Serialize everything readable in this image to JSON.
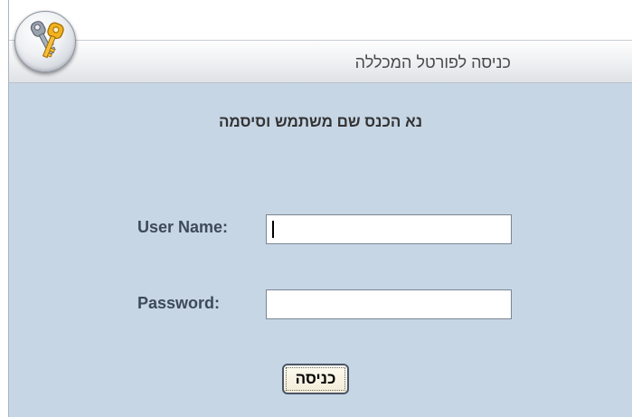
{
  "header": {
    "title": "כניסה לפורטל המכללה",
    "logo_icon": "keys-icon"
  },
  "form": {
    "prompt": "נא הכנס שם משתמש וסיסמה",
    "username_label": "User Name:",
    "username_value": "",
    "password_label": "Password:",
    "password_value": "",
    "submit_label": "כניסה"
  },
  "colors": {
    "panel_background": "#c7d6e5",
    "label_text": "#3d4a5a"
  }
}
